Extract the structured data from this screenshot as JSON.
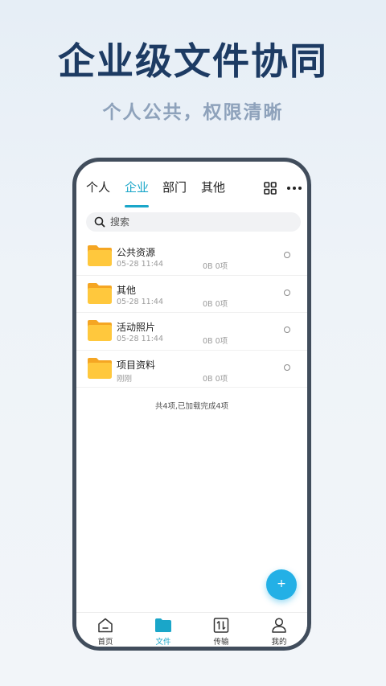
{
  "promo": {
    "headline": "企业级文件协同",
    "subline": "个人公共，权限清晰"
  },
  "tabs": [
    {
      "label": "个人",
      "active": false
    },
    {
      "label": "企业",
      "active": true
    },
    {
      "label": "部门",
      "active": false
    },
    {
      "label": "其他",
      "active": false
    }
  ],
  "toolbar": {
    "grid_icon": "grid-view-icon",
    "more_icon": "more-dots-icon"
  },
  "search": {
    "placeholder": "搜索",
    "value": ""
  },
  "files": [
    {
      "name": "公共资源",
      "time": "05-28 11:44",
      "size": "0B 0项"
    },
    {
      "name": "其他",
      "time": "05-28 11:44",
      "size": "0B 0项"
    },
    {
      "name": "活动照片",
      "time": "05-28 11:44",
      "size": "0B 0项"
    },
    {
      "name": "项目资料",
      "time": "刚刚",
      "size": "0B 0项"
    }
  ],
  "list_footer": "共4项,已加载完成4项",
  "fab": {
    "label": "+"
  },
  "nav": [
    {
      "label": "首页",
      "icon": "home-icon",
      "active": false
    },
    {
      "label": "文件",
      "icon": "folder-icon",
      "active": true
    },
    {
      "label": "传输",
      "icon": "transfer-icon",
      "active": false
    },
    {
      "label": "我的",
      "icon": "user-icon",
      "active": false
    }
  ],
  "colors": {
    "accent": "#1aa6c9",
    "folder": "#ffc83d",
    "fab": "#23b0e6",
    "frame": "#414d5c",
    "headline": "#1d3b63"
  }
}
